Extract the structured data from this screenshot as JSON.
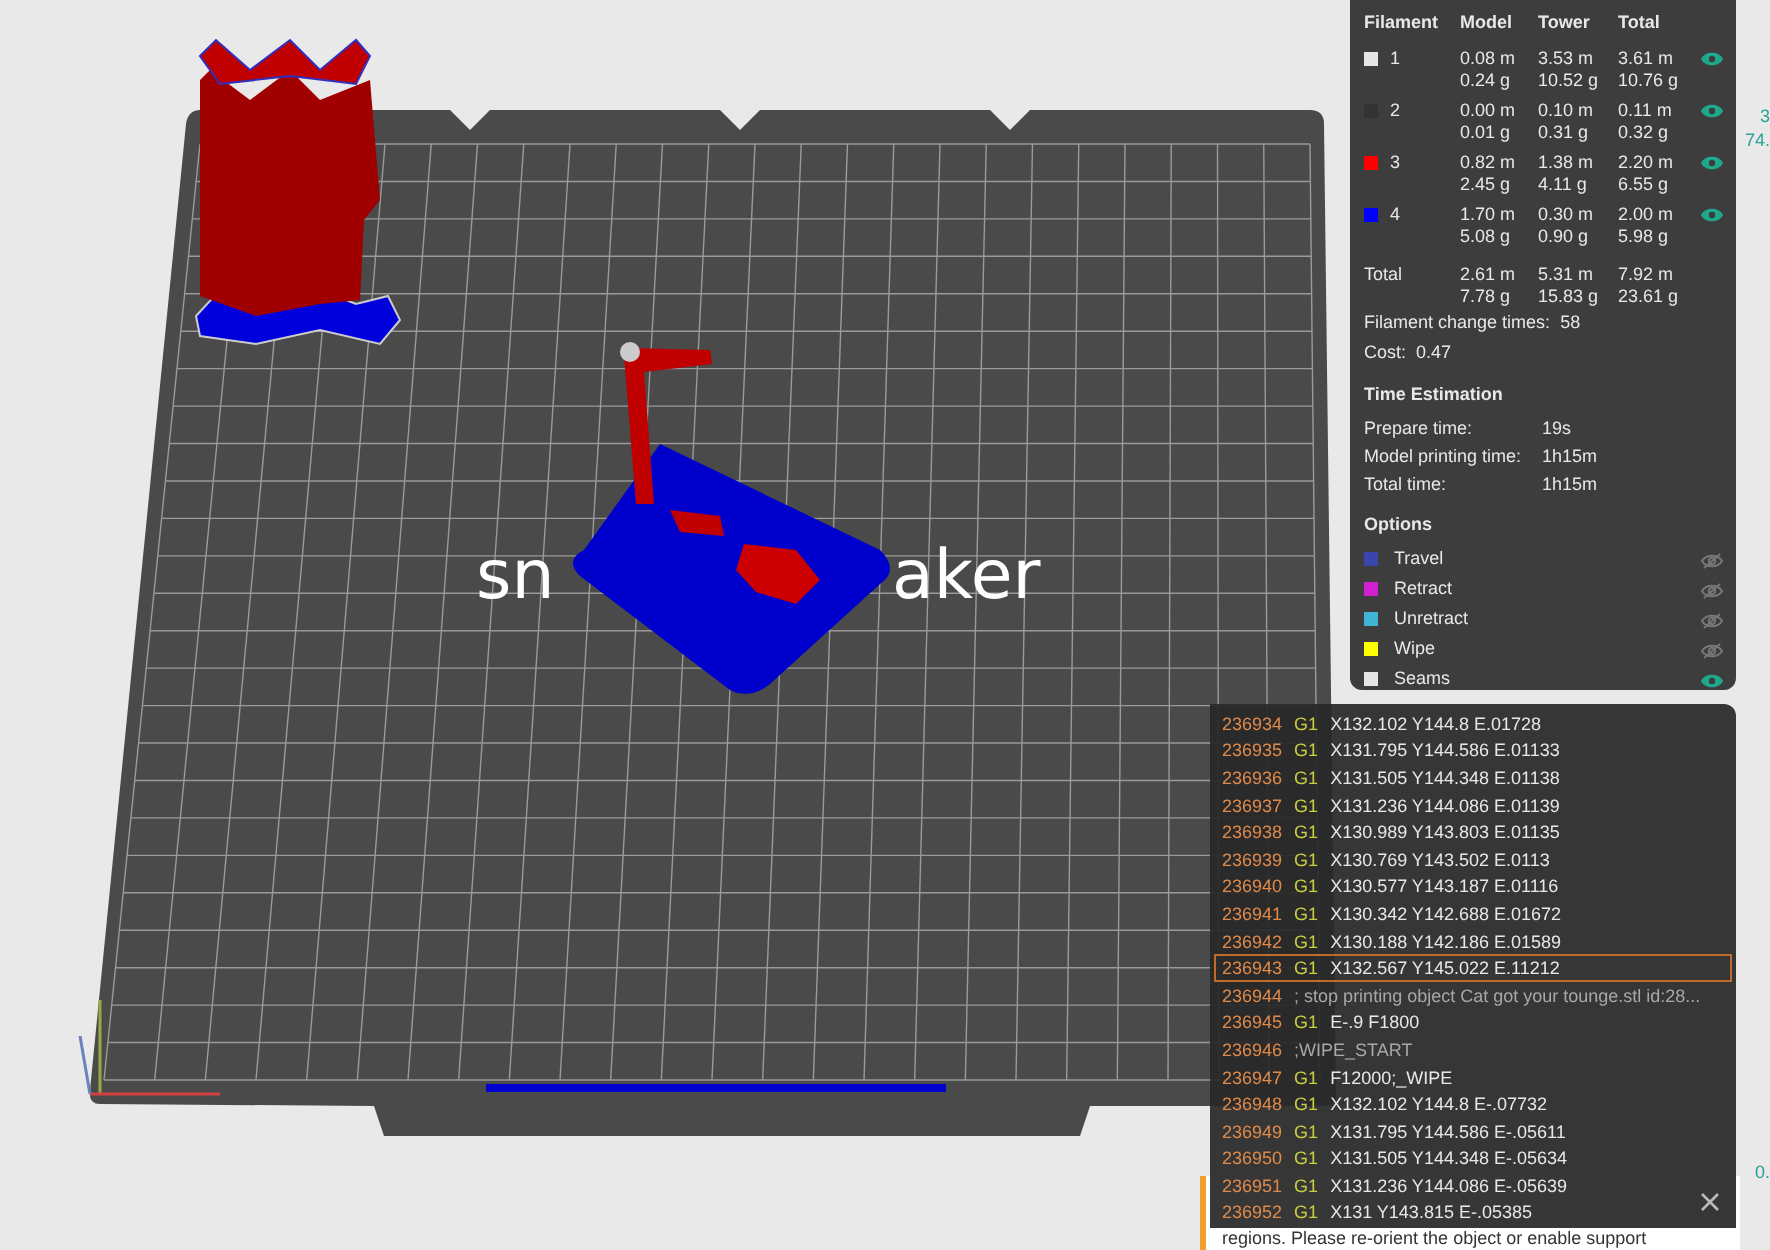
{
  "bed_logo": [
    "sn",
    "aker"
  ],
  "filament_table": {
    "columns": [
      "Filament",
      "Model",
      "Tower",
      "Total"
    ],
    "rows": [
      {
        "id": "1",
        "color": "#e6e6e6",
        "model": [
          "0.08 m",
          "0.24 g"
        ],
        "tower": [
          "3.53 m",
          "10.52 g"
        ],
        "total": [
          "3.61 m",
          "10.76 g"
        ],
        "visible": true
      },
      {
        "id": "2",
        "color": "#333333",
        "model": [
          "0.00 m",
          "0.01 g"
        ],
        "tower": [
          "0.10 m",
          "0.31 g"
        ],
        "total": [
          "0.11 m",
          "0.32 g"
        ],
        "visible": true
      },
      {
        "id": "3",
        "color": "#ff0000",
        "model": [
          "0.82 m",
          "2.45 g"
        ],
        "tower": [
          "1.38 m",
          "4.11 g"
        ],
        "total": [
          "2.20 m",
          "6.55 g"
        ],
        "visible": true
      },
      {
        "id": "4",
        "color": "#0000ff",
        "model": [
          "1.70 m",
          "5.08 g"
        ],
        "tower": [
          "0.30 m",
          "0.90 g"
        ],
        "total": [
          "2.00 m",
          "5.98 g"
        ],
        "visible": true
      }
    ],
    "total": {
      "label": "Total",
      "model": [
        "2.61 m",
        "7.78 g"
      ],
      "tower": [
        "5.31 m",
        "15.83 g"
      ],
      "total": [
        "7.92 m",
        "23.61 g"
      ]
    }
  },
  "filament_change": {
    "label": "Filament change times:",
    "value": "58"
  },
  "cost": {
    "label": "Cost:",
    "value": "0.47"
  },
  "time_estimation": {
    "title": "Time Estimation",
    "rows": [
      {
        "label": "Prepare time:",
        "value": "19s"
      },
      {
        "label": "Model printing time:",
        "value": "1h15m"
      },
      {
        "label": "Total time:",
        "value": "1h15m"
      }
    ]
  },
  "options": {
    "title": "Options",
    "items": [
      {
        "label": "Travel",
        "color": "#3a45b0",
        "visible": false
      },
      {
        "label": "Retract",
        "color": "#d020d0",
        "visible": false
      },
      {
        "label": "Unretract",
        "color": "#40b4d4",
        "visible": false
      },
      {
        "label": "Wipe",
        "color": "#ffff00",
        "visible": false
      },
      {
        "label": "Seams",
        "color": "#e6e6e6",
        "visible": true
      }
    ]
  },
  "edge_labels": [
    "3",
    "74.",
    "0."
  ],
  "gcode": [
    {
      "line": "236934",
      "cmd": "G1",
      "args": "X132.102 Y144.8 E.01728",
      "selected": false
    },
    {
      "line": "236935",
      "cmd": "G1",
      "args": "X131.795 Y144.586 E.01133",
      "selected": false
    },
    {
      "line": "236936",
      "cmd": "G1",
      "args": "X131.505 Y144.348 E.01138",
      "selected": false
    },
    {
      "line": "236937",
      "cmd": "G1",
      "args": "X131.236 Y144.086 E.01139",
      "selected": false
    },
    {
      "line": "236938",
      "cmd": "G1",
      "args": "X130.989 Y143.803 E.01135",
      "selected": false
    },
    {
      "line": "236939",
      "cmd": "G1",
      "args": "X130.769 Y143.502 E.0113",
      "selected": false
    },
    {
      "line": "236940",
      "cmd": "G1",
      "args": "X130.577 Y143.187 E.01116",
      "selected": false
    },
    {
      "line": "236941",
      "cmd": "G1",
      "args": "X130.342 Y142.688 E.01672",
      "selected": false
    },
    {
      "line": "236942",
      "cmd": "G1",
      "args": "X130.188 Y142.186 E.01589",
      "selected": false
    },
    {
      "line": "236943",
      "cmd": "G1",
      "args": "X132.567 Y145.022 E.11212",
      "selected": true
    },
    {
      "line": "236944",
      "args": "; stop printing object Cat got your tounge.stl id:28...",
      "selected": false
    },
    {
      "line": "236945",
      "cmd": "G1",
      "args": "E-.9 F1800",
      "selected": false
    },
    {
      "line": "236946",
      "args": ";WIPE_START",
      "selected": false
    },
    {
      "line": "236947",
      "cmd": "G1",
      "args": "F12000;_WIPE",
      "selected": false
    },
    {
      "line": "236948",
      "cmd": "G1",
      "args": "X132.102 Y144.8 E-.07732",
      "selected": false
    },
    {
      "line": "236949",
      "cmd": "G1",
      "args": "X131.795 Y144.586 E-.05611",
      "selected": false
    },
    {
      "line": "236950",
      "cmd": "G1",
      "args": "X131.505 Y144.348 E-.05634",
      "selected": false
    },
    {
      "line": "236951",
      "cmd": "G1",
      "args": "X131.236 Y144.086 E-.05639",
      "selected": false
    },
    {
      "line": "236952",
      "cmd": "G1",
      "args": "X131 Y143.815 E-.05385",
      "selected": false
    }
  ],
  "warning": {
    "text": "regions. Please re-orient the object or enable support"
  }
}
